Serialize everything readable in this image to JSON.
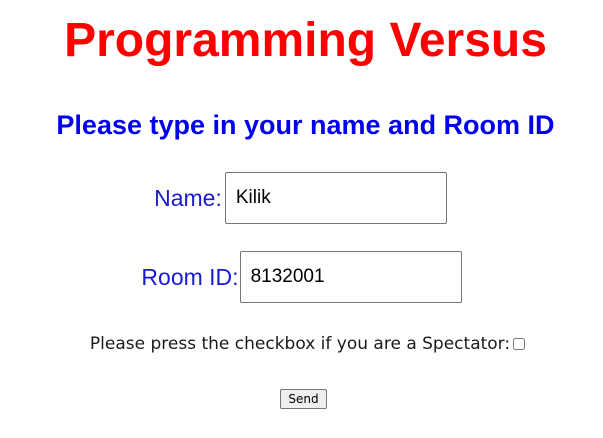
{
  "app": {
    "title": "Programming Versus",
    "instruction": "Please type in your name and Room ID"
  },
  "form": {
    "name": {
      "label": "Name:",
      "value": "Kilik"
    },
    "room_id": {
      "label": "Room ID:",
      "value": "8132001"
    },
    "spectator": {
      "label": "Please press the checkbox if you are a Spectator:",
      "checked": false
    },
    "send_label": "Send"
  },
  "colors": {
    "title": "#ff0000",
    "subtitle": "#0000ee",
    "label": "#1a1ad6",
    "text": "#1a1a1a"
  }
}
